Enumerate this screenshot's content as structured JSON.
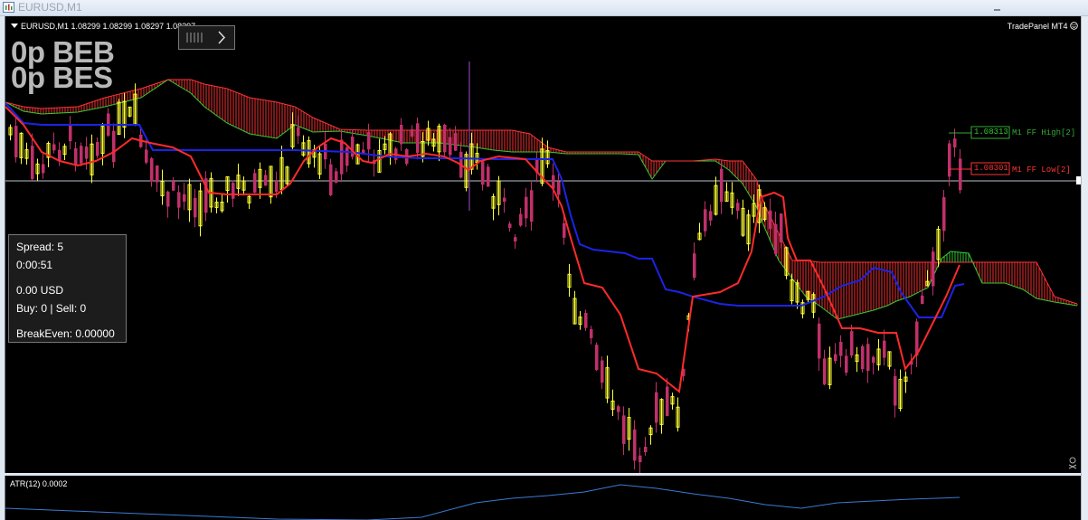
{
  "window": {
    "title": "EURUSD,M1"
  },
  "chart": {
    "symbol_header": "EURUSD,M1  1.08299 1.08299 1.08297 1.08297",
    "big_line_1": "0p BEB",
    "big_line_2": "0p BES",
    "trade_panel_label": "TradePanel MT4",
    "ff_high": {
      "price": "1.08313",
      "label": "M1 FF High[2]"
    },
    "ff_low": {
      "price": "1.08301",
      "label": "M1 FF Low[2]"
    }
  },
  "info_panel": {
    "spread": "Spread: 5",
    "timer": "0:00:51",
    "pnl": "0.00 USD",
    "orders": "Buy: 0 | Sell: 0",
    "breakeven": "BreakEven: 0.00000"
  },
  "indicator": {
    "label": "ATR(12) 0.0002"
  },
  "colors": {
    "bull": "#ffff33",
    "bear": "#c0306a",
    "tenkan": "#ff2a2a",
    "kijun": "#1c23e6",
    "span_a": "#33cc33",
    "span_b": "#ff3333",
    "atr": "#3a7bd5",
    "chikou": "#8a3fb0"
  },
  "icons": [
    "app-icon",
    "chevron-right-icon",
    "smiley-icon",
    "skull-icon"
  ]
}
